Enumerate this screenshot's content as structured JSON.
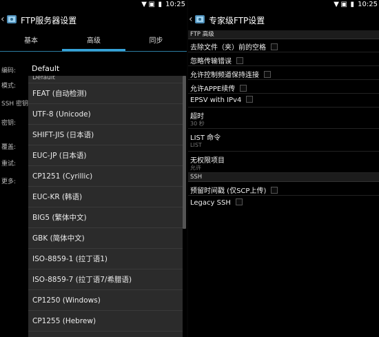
{
  "status": {
    "time": "10:25"
  },
  "left": {
    "title": "FTP服务器设置",
    "tabs": [
      {
        "label": "基本",
        "selected": false
      },
      {
        "label": "高级",
        "selected": true
      },
      {
        "label": "同步",
        "selected": false
      }
    ],
    "settings": [
      {
        "label": "编码:",
        "value": "Default"
      },
      {
        "label": "模式:"
      },
      {
        "label": "SSH 密钥:"
      },
      {
        "label": "密钥:"
      },
      {
        "label": "覆盖:"
      },
      {
        "label": "重试:"
      },
      {
        "label": "更多:"
      }
    ],
    "dropdown": {
      "partial_item": "Default",
      "items": [
        "FEAT (自动检测)",
        "UTF-8 (Unicode)",
        "SHIFT-JIS (日本语)",
        "EUC-JP (日本语)",
        "CP1251 (Cyrillic)",
        "EUC-KR (韩语)",
        "BIG5 (繁体中文)",
        "GBK (简体中文)",
        "ISO-8859-1 (拉丁语1)",
        "ISO-8859-7 (拉丁语7/希腊语)",
        "CP1250 (Windows)",
        "CP1255 (Hebrew)"
      ]
    }
  },
  "right": {
    "title": "专家级FTP设置",
    "sections": [
      {
        "header": "FTP 高级",
        "items": [
          {
            "label": "去除文件（夹）前的空格",
            "checkbox": true
          },
          {
            "label": "忽略传输错误",
            "checkbox": true
          },
          {
            "label": "允许控制频道保持连接",
            "checkbox": true
          },
          {
            "label": "允许APPE续传",
            "checkbox": true
          },
          {
            "label": "EPSV with IPv4",
            "checkbox": true
          },
          {
            "label": "超时",
            "summary": "30 秒"
          },
          {
            "label": "LIST 命令",
            "summary": "LIST"
          },
          {
            "label": "无权限项目",
            "summary": "允许"
          }
        ]
      },
      {
        "header": "SSH",
        "items": [
          {
            "label": "预留时间戳 (仅SCP上传)",
            "checkbox": true
          },
          {
            "label": "Legacy SSH",
            "checkbox": true
          }
        ]
      }
    ]
  }
}
